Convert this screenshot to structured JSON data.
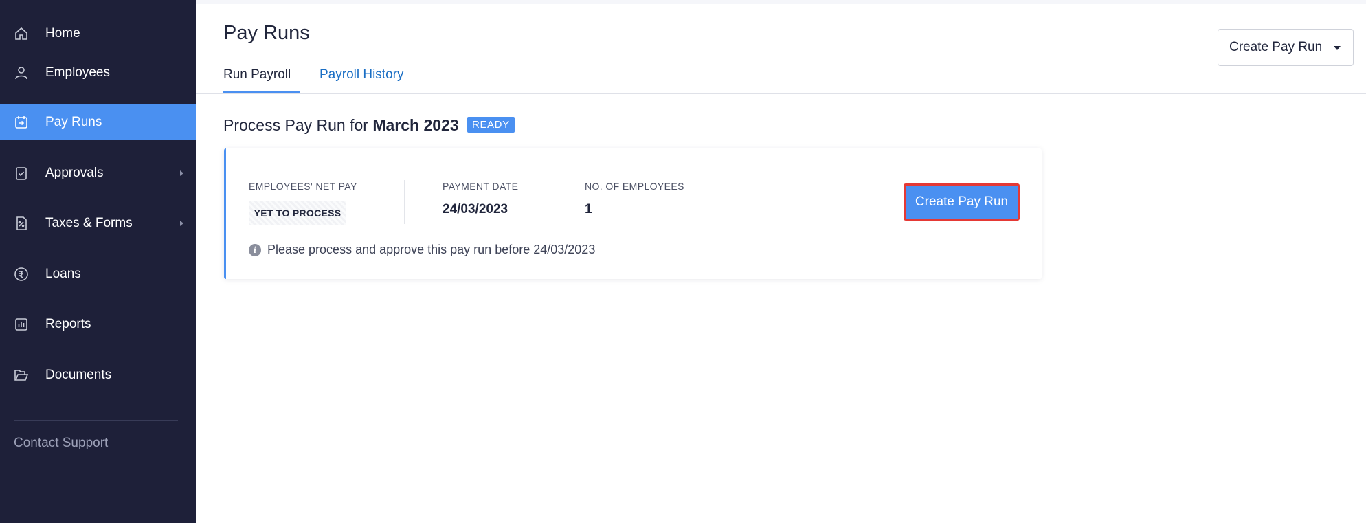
{
  "sidebar": {
    "items": [
      {
        "label": "Home",
        "icon": "home-icon"
      },
      {
        "label": "Employees",
        "icon": "user-icon"
      },
      {
        "label": "Pay Runs",
        "icon": "payrun-icon",
        "active": true
      },
      {
        "label": "Approvals",
        "icon": "approval-icon",
        "has_submenu": true
      },
      {
        "label": "Taxes & Forms",
        "icon": "tax-form-icon",
        "has_submenu": true
      },
      {
        "label": "Loans",
        "icon": "rupee-icon"
      },
      {
        "label": "Reports",
        "icon": "reports-icon"
      },
      {
        "label": "Documents",
        "icon": "folder-icon"
      }
    ],
    "contact_support": "Contact Support"
  },
  "header": {
    "title": "Pay Runs",
    "create_button": "Create Pay Run"
  },
  "tabs": [
    {
      "label": "Run Payroll",
      "active": true
    },
    {
      "label": "Payroll History",
      "active": false
    }
  ],
  "section": {
    "title_prefix": "Process Pay Run for",
    "month": "March 2023",
    "badge": "READY"
  },
  "card": {
    "net_pay_label": "EMPLOYEES' NET PAY",
    "net_pay_status": "YET TO PROCESS",
    "payment_date_label": "PAYMENT DATE",
    "payment_date": "24/03/2023",
    "employees_label": "NO. OF EMPLOYEES",
    "employees_count": "1",
    "action_button": "Create Pay Run",
    "note": "Please process and approve this pay run before 24/03/2023"
  },
  "colors": {
    "sidebar_bg": "#1e2039",
    "accent": "#4a90f1",
    "highlight_border": "#e53935",
    "link": "#1a6ec4"
  }
}
